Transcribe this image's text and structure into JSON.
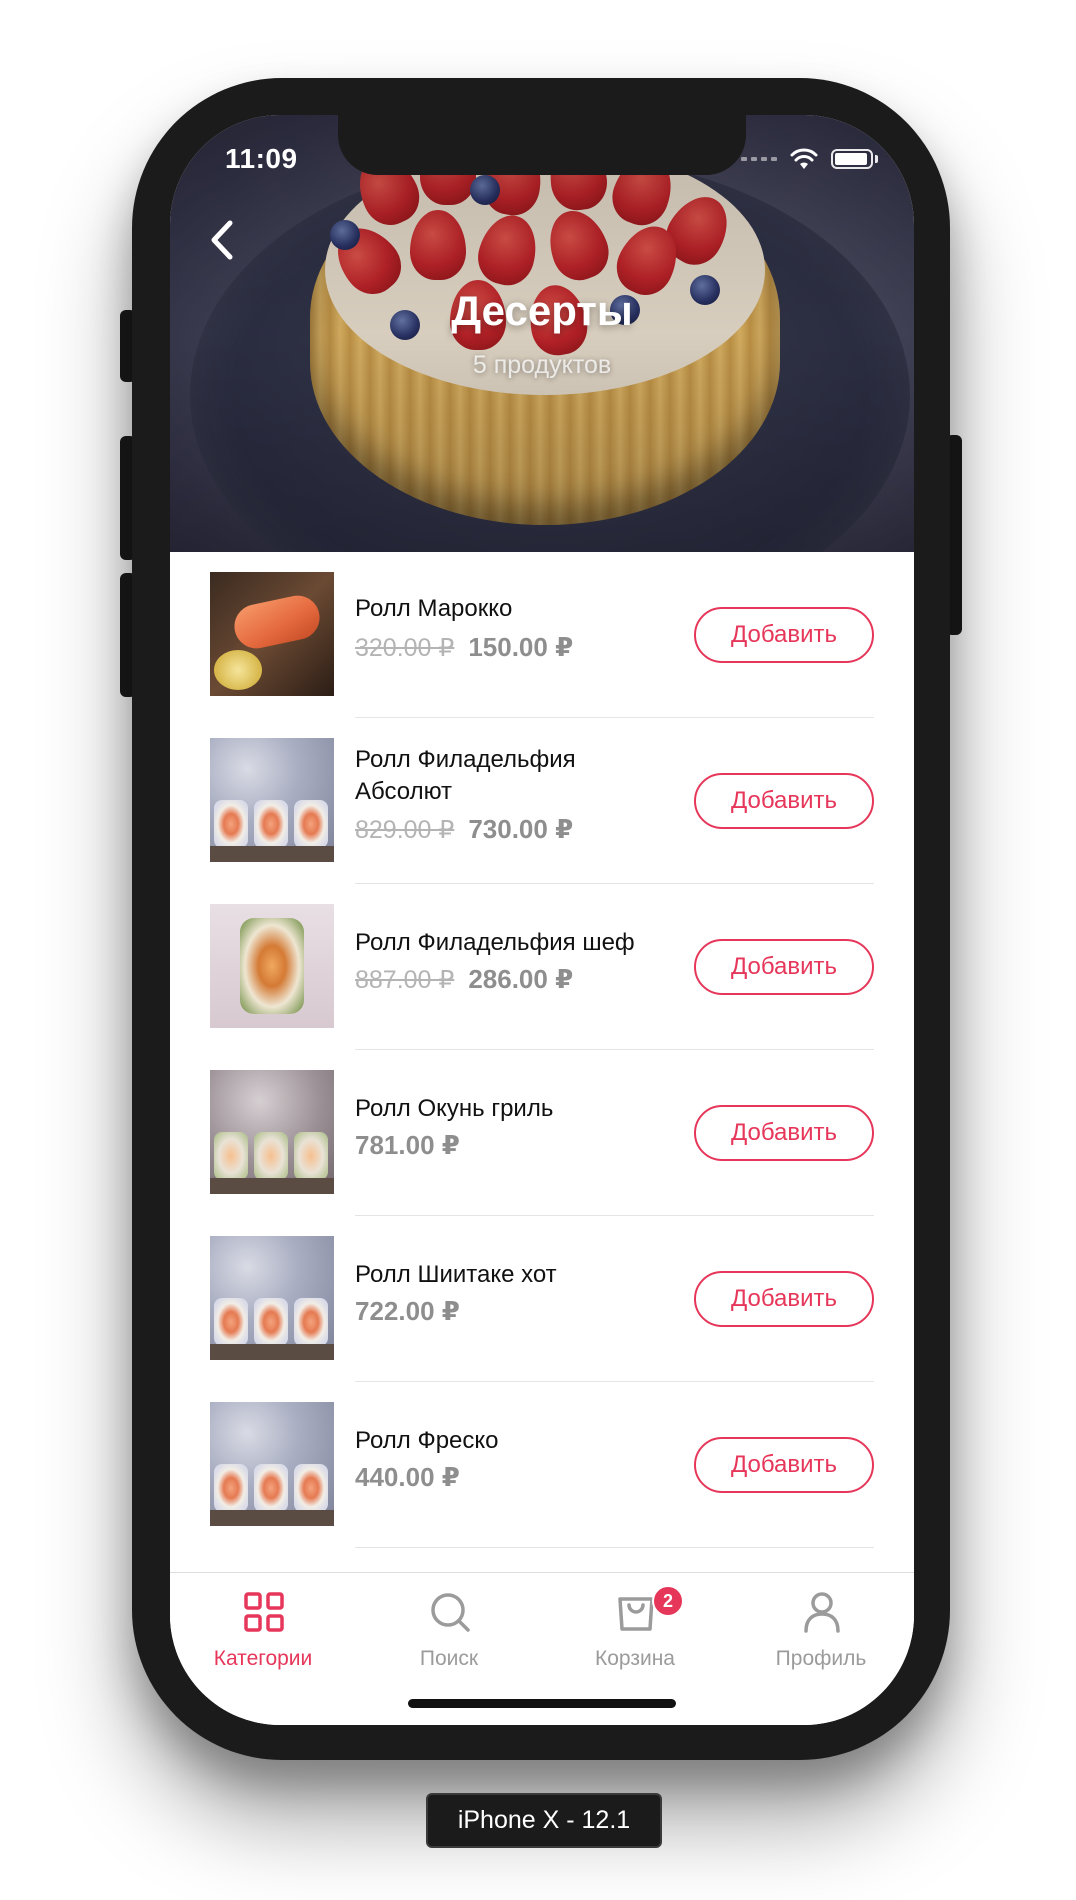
{
  "status_bar": {
    "time": "11:09"
  },
  "header": {
    "title": "Десерты",
    "subtitle": "5 продуктов"
  },
  "products": [
    {
      "name": "Ролл Марокко",
      "old_price": "320.00 ₽",
      "price": "150.00 ₽",
      "add_label": "Добавить"
    },
    {
      "name_line1": "Ролл Филадельфия",
      "name_line2": "Абсолют",
      "old_price": "829.00 ₽",
      "price": "730.00 ₽",
      "add_label": "Добавить"
    },
    {
      "name": "Ролл Филадельфия шеф",
      "old_price": "887.00 ₽",
      "price": "286.00 ₽",
      "add_label": "Добавить"
    },
    {
      "name": "Ролл Окунь гриль",
      "price": "781.00 ₽",
      "add_label": "Добавить"
    },
    {
      "name": "Ролл Шиитаке хот",
      "price": "722.00 ₽",
      "add_label": "Добавить"
    },
    {
      "name": "Ролл Фреско",
      "price": "440.00 ₽",
      "add_label": "Добавить"
    }
  ],
  "tabbar": {
    "tabs": [
      {
        "label": "Категории",
        "icon": "grid-icon",
        "active": true
      },
      {
        "label": "Поиск",
        "icon": "search-icon",
        "active": false
      },
      {
        "label": "Корзина",
        "icon": "cart-icon",
        "active": false,
        "badge": "2"
      },
      {
        "label": "Профиль",
        "icon": "profile-icon",
        "active": false
      }
    ]
  },
  "device_label": "iPhone X - 12.1",
  "colors": {
    "accent": "#e6375a",
    "inactive": "#9b9b9b",
    "text": "#111111"
  }
}
